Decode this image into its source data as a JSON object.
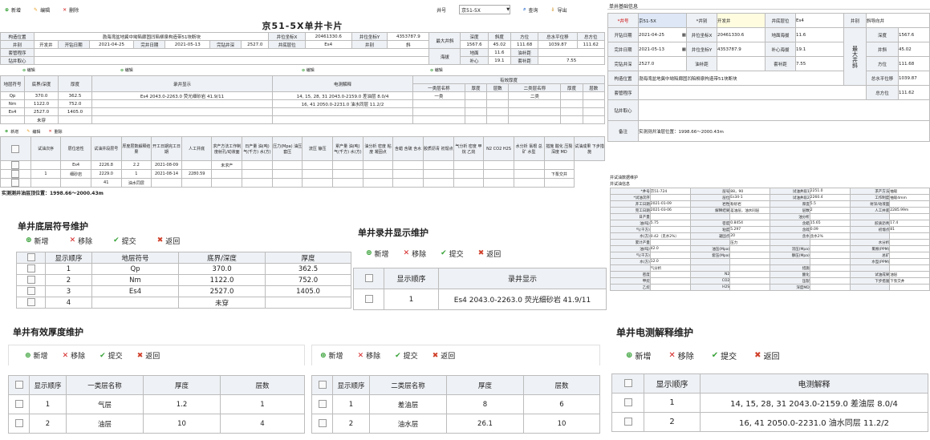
{
  "card": {
    "toolbar": {
      "add": "新增",
      "edit": "编辑",
      "del": "删除",
      "well_no_label": "井号",
      "well_no_value": "京51-5X",
      "query": "查询",
      "export": "导出"
    },
    "title": "京51-5X单井卡片",
    "r1": {
      "k1": "构造位置",
      "v1": "渤海湾盆地冀中坳陷廊固凹陷柳泉构造带51块断块",
      "k2": "井位坐标X",
      "v2": "20461330.6",
      "k3": "井位坐标Y",
      "v3": "4353787.9"
    },
    "r2": {
      "k1": "井别",
      "v1": "开发井",
      "k2": "开钻日期",
      "v2": "2021-04-25",
      "k3": "完井日期",
      "v3": "2021-05-13",
      "k4": "完钻井深",
      "v4": "2527.0",
      "k5": "井底层位",
      "v5": "Es4",
      "k6": "井别",
      "v6": "斜",
      "k7": "井底层位",
      "v7": "Es4"
    },
    "r3": {
      "k1": "套管程序"
    },
    "r4": {
      "k1": "钻井取心"
    },
    "max": {
      "label": "最大井斜",
      "h": [
        "深度",
        "斜度",
        "方位",
        "总水平位移",
        "总方位"
      ],
      "v": [
        "1567.6",
        "45.02",
        "111.68",
        "1039.87",
        "111.62"
      ]
    },
    "alt": {
      "label": "海拔",
      "k1": "地面",
      "v1": "11.6",
      "k2": "油补距",
      "k3": "补心",
      "v3": "19.1",
      "k4": "套补距",
      "v4": "7.55"
    },
    "sec_edit": "编辑",
    "strata": {
      "headers": [
        "地层符号",
        "底界/深度",
        "厚度"
      ],
      "rows": [
        [
          "Qp",
          "370.0",
          "362.5"
        ],
        [
          "Nm",
          "1122.0",
          "752.0"
        ],
        [
          "Es4",
          "2527.0",
          "1405.0"
        ],
        [
          "",
          "未穿",
          ""
        ]
      ]
    },
    "log_disp": {
      "header": "录井显示",
      "rows": [
        "Es4 2043.0-2263.0 荧光细砂岩 41.9/11"
      ]
    },
    "elec": {
      "header": "电测解释",
      "rows": [
        "14, 15, 28, 31 2043.0-2159.0 差油层 8.0/4",
        "16, 41 2050.0-2231.0 油水同层 11.2/2"
      ]
    },
    "eff": {
      "header": "有效厚度",
      "sub": [
        "一类层名称",
        "厚度",
        "层数",
        "二类层名称",
        "厚度",
        "层数"
      ],
      "rows": [
        [
          "一类",
          "",
          "",
          "二类",
          "",
          ""
        ]
      ]
    },
    "test": {
      "headers": [
        "试油次序",
        "层位岩性",
        "试油井段层号",
        "厚度层数解释结果",
        "开工日期完工日期",
        "人工井底",
        "求产方法工作制度射孔/动液面",
        "日产量 油(吨) 气(千方) 水(方)",
        "压力(Mpa) 油压 套压",
        "流压 静压",
        "累产量 油(吨) 气(千方) 水(方)",
        "油分析 密度 粘度 凝固点",
        "含蜡 含硫 含水",
        "胶质沥青 初馏点",
        "气分析 密度 甲烷 乙烷",
        "N2 CO2 H2S",
        "水分析 氯根 总矿 水型",
        "措施 酸化 压裂 深度 MD",
        "试油成果 下步措施"
      ],
      "rows": [
        [
          "",
          "Es4",
          "2226.8",
          "2.2",
          "2021-08-09",
          "",
          "未求产"
        ],
        [
          "1",
          "细砂岩",
          "2229.0",
          "1",
          "2021-08-14",
          "2280.59",
          ""
        ],
        [
          "",
          "",
          "41",
          "油水同层",
          "",
          "",
          ""
        ]
      ],
      "next": "下泵交井"
    },
    "footer": "实测测井油层顶位置：1998.66～2000.43m"
  },
  "info": {
    "title": "单井基础信息",
    "well_no_k": "*井号",
    "well_no_v": "京51-5X",
    "well_type_k": "*井别",
    "well_type_v": "开发井",
    "bottom_k": "井底层位",
    "bottom_v": "Es4",
    "shape_k": "井别",
    "shape_v": "斜导向井",
    "spud_k": "开钻日期",
    "spud_v": "2021-04-25",
    "x_k": "井位坐标X",
    "x_v": "20461330.6",
    "ground_k": "地面海拔",
    "ground_v": "11.6",
    "depth_k": "深度",
    "depth_v": "1567.6",
    "comp_k": "完井日期",
    "comp_v": "2021-05-13",
    "y_k": "井位坐标Y",
    "y_v": "4353787.9",
    "kelly_k": "补心海拔",
    "kelly_v": "19.1",
    "incl_k": "井斜",
    "incl_v": "45.02",
    "md_k": "完钻井深",
    "md_v": "2527.0",
    "oil_k": "油补距",
    "casing_k": "套补距",
    "casing_v": "7.55",
    "azi_k": "方位",
    "azi_v": "111.68",
    "max_label": "最大井斜",
    "loc_k": "构造位置",
    "loc_v": "渤海湾盆地冀中坳陷廊固凹陷柳泉构造带51块断块",
    "hdisp_k": "总水平位移",
    "hdisp_v": "1039.87",
    "csg_k": "套管程序",
    "tazi_k": "总方位",
    "tazi_v": "111.62",
    "core_k": "钻井取心",
    "note_k": "备注",
    "note_v": "实测测井油层位置：1998.66～2000.43m"
  },
  "test_info": {
    "title": "井试油数据维护",
    "sub": "井试油信息",
    "rows": [
      [
        "*井号",
        "京51-724",
        "层号",
        "88，90",
        "试油井段1",
        "2251.0",
        "求产方法",
        "抽吸"
      ],
      [
        "*试油次序",
        "",
        "层位",
        "Es34-1",
        "试油井段2",
        "2260.4",
        "工作制度",
        "抽吸4mm"
      ],
      [
        "开工日期",
        "2021-01-09",
        "岩性",
        "粉砂岩",
        "厚度",
        "5.5",
        "射深/动液面",
        ""
      ],
      [
        "完工日期",
        "2021-03-06",
        "解释结果",
        "差油层，油水同层",
        "层数",
        "2",
        "人工井底",
        "2285.99m"
      ],
      [
        "日产量",
        "",
        "",
        "",
        "油分析",
        "",
        "",
        ""
      ],
      [
        "油(吨)",
        "5.75",
        "密度",
        "0.8454",
        "含蜡",
        "15.65",
        "胶质沥青",
        "17.4"
      ],
      [
        "气(千方)",
        "",
        "粘度",
        "5.297",
        "含硫",
        "0.09",
        "初馏点",
        "81"
      ],
      [
        "水(方)",
        "0.42（见水2%）",
        "凝固点",
        "20",
        "含水",
        "含水2%",
        "",
        ""
      ],
      [
        "累计产量",
        "",
        "",
        "压力",
        "",
        "",
        "水分析",
        ""
      ],
      [
        "油(吨)",
        "42.0",
        "油压(Mpa)",
        "",
        "流压(Mpa)",
        "",
        "氯根(PPM)",
        ""
      ],
      [
        "气(千方)",
        "",
        "套压(Mpa)",
        "",
        "静压(Mpa)",
        "",
        "总矿",
        ""
      ],
      [
        "水(方)",
        "12.0",
        "",
        "",
        "",
        "",
        "水型(PPM)",
        ""
      ],
      [
        "",
        "气分析",
        "",
        "",
        "措施",
        "",
        "",
        ""
      ],
      [
        "密度",
        "",
        "N2",
        "",
        "酸化",
        "",
        "试油成果",
        "油层"
      ],
      [
        "甲烷",
        "",
        "CO2",
        "",
        "压裂",
        "",
        "下步措施",
        "下泵交井"
      ],
      [
        "乙烷",
        "",
        "H2S",
        "",
        "深度MD",
        "",
        "",
        ""
      ]
    ]
  },
  "strata_maint": {
    "title": "单井底层符号维护",
    "add": "新增",
    "remove": "移除",
    "submit": "提交",
    "back": "返回",
    "headers": [
      "显示顺序",
      "地层符号",
      "底界/深度",
      "厚度"
    ],
    "rows": [
      [
        "1",
        "Qp",
        "370.0",
        "362.5"
      ],
      [
        "2",
        "Nm",
        "1122.0",
        "752.0"
      ],
      [
        "3",
        "Es4",
        "2527.0",
        "1405.0"
      ],
      [
        "4",
        "",
        "未穿",
        ""
      ]
    ]
  },
  "log_maint": {
    "title": "单井录井显示维护",
    "add": "新增",
    "remove": "移除",
    "submit": "提交",
    "back": "返回",
    "headers": [
      "显示顺序",
      "录井显示"
    ],
    "rows": [
      [
        "1",
        "Es4 2043.0-2263.0 荧光细砂岩 41.9/11"
      ]
    ]
  },
  "eff_maint": {
    "title": "单井有效厚度维护",
    "add": "新增",
    "remove": "移除",
    "submit": "提交",
    "back": "返回",
    "t1": {
      "headers": [
        "显示顺序",
        "一类层名称",
        "厚度",
        "层数"
      ],
      "rows": [
        [
          "1",
          "气层",
          "1.2",
          "1"
        ],
        [
          "2",
          "油层",
          "10",
          "4"
        ]
      ]
    },
    "t2": {
      "headers": [
        "显示顺序",
        "二类层名称",
        "厚度",
        "层数"
      ],
      "rows": [
        [
          "1",
          "差油层",
          "8",
          "6"
        ],
        [
          "2",
          "油水层",
          "26.1",
          "10"
        ]
      ]
    }
  },
  "elec_maint": {
    "title": "单井电测解释维护",
    "add": "新增",
    "remove": "移除",
    "submit": "提交",
    "back": "返回",
    "headers": [
      "显示顺序",
      "电测解释"
    ],
    "rows": [
      [
        "1",
        "14, 15, 28, 31 2043.0-2159.0 差油层 8.0/4"
      ],
      [
        "2",
        "16, 41 2050.0-2231.0 油水同层 11.2/2"
      ]
    ]
  }
}
